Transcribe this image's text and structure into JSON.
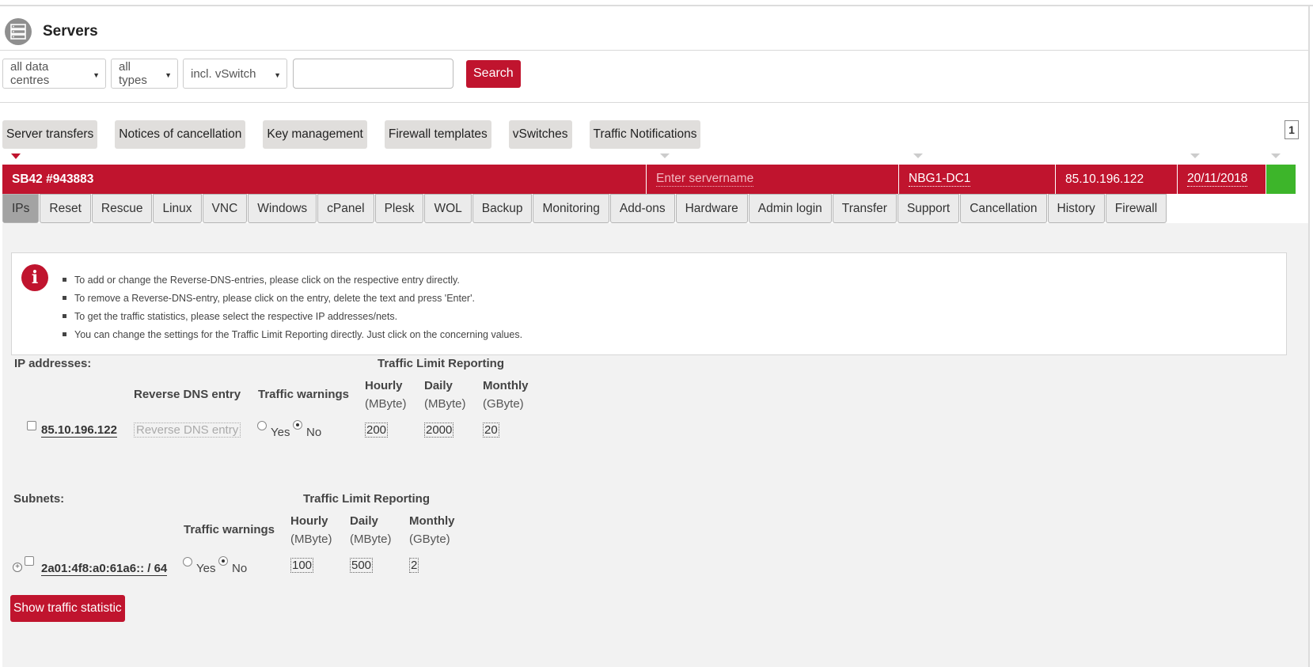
{
  "header": {
    "title": "Servers",
    "icon": "server-icon"
  },
  "filters": {
    "datacentre": "all data centres",
    "type": "all types",
    "vswitch": "incl. vSwitch",
    "search_value": "",
    "search_label": "Search"
  },
  "toolbar": {
    "buttons": [
      "Server transfers",
      "Notices of cancellation",
      "Key management",
      "Firewall templates",
      "vSwitches",
      "Traffic Notifications"
    ],
    "page": "1"
  },
  "server": {
    "name": "SB42 #943883",
    "servername_placeholder": "Enter servername",
    "datacentre": "NBG1-DC1",
    "ip": "85.10.196.122",
    "date": "20/11/2018",
    "status_color": "#3db52a"
  },
  "tabs": [
    "IPs",
    "Reset",
    "Rescue",
    "Linux",
    "VNC",
    "Windows",
    "cPanel",
    "Plesk",
    "WOL",
    "Backup",
    "Monitoring",
    "Add-ons",
    "Hardware",
    "Admin login",
    "Transfer",
    "Support",
    "Cancellation",
    "History",
    "Firewall"
  ],
  "info": {
    "items": [
      "To add or change the Reverse-DNS-entries, please click on the respective entry directly.",
      "To remove a Reverse-DNS-entry, please click on the entry, delete the text and press 'Enter'.",
      "To get the traffic statistics, please select the respective IP addresses/nets.",
      "You can change the settings for the Traffic Limit Reporting directly. Just click on the concerning values."
    ]
  },
  "ip_section": {
    "title": "IP addresses:",
    "traffic_limit_heading": "Traffic Limit Reporting",
    "col_rdns": "Reverse DNS entry",
    "col_warnings": "Traffic warnings",
    "col_hourly": "Hourly",
    "col_daily": "Daily",
    "col_monthly": "Monthly",
    "unit_hourly": "(MByte)",
    "unit_daily": "(MByte)",
    "unit_monthly": "(GByte)",
    "row": {
      "ip": "85.10.196.122",
      "rdns_placeholder": "Reverse DNS entry",
      "yes": "Yes",
      "no": "No",
      "hourly": "200",
      "daily": "2000",
      "monthly": "20"
    }
  },
  "subnet_section": {
    "title": "Subnets:",
    "traffic_limit_heading": "Traffic Limit Reporting",
    "col_warnings": "Traffic warnings",
    "col_hourly": "Hourly",
    "col_daily": "Daily",
    "col_monthly": "Monthly",
    "unit_hourly": "(MByte)",
    "unit_daily": "(MByte)",
    "unit_monthly": "(GByte)",
    "row": {
      "subnet": "2a01:4f8:a0:61a6:: / 64",
      "yes": "Yes",
      "no": "No",
      "hourly": "100",
      "daily": "500",
      "monthly": "2"
    }
  },
  "actions": {
    "show_traffic": "Show traffic statistic"
  }
}
